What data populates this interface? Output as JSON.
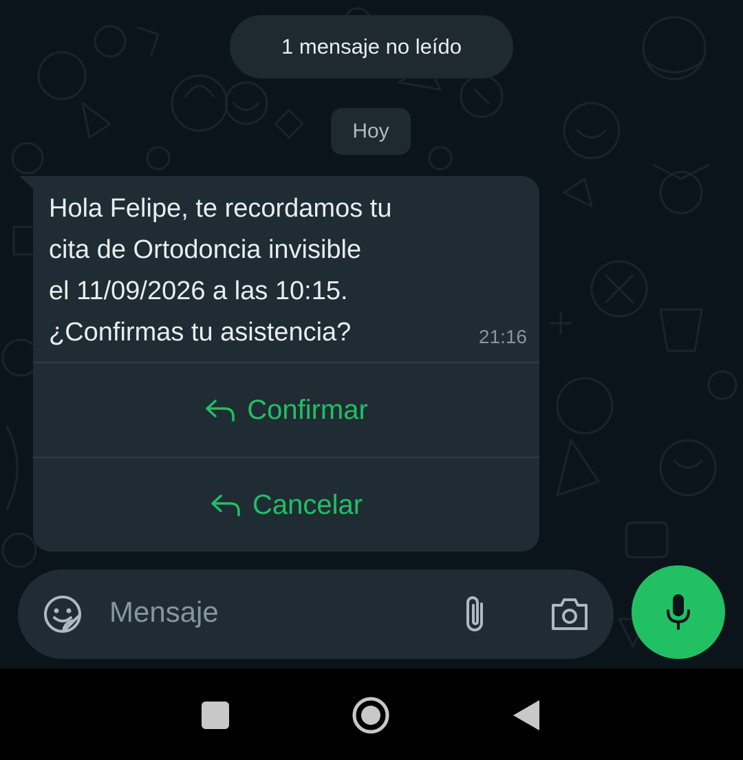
{
  "chat": {
    "unread_banner": "1 mensaje no leído",
    "date_separator": "Hoy",
    "message": {
      "lines": [
        "Hola Felipe, te recordamos tu",
        "cita de Ortodoncia invisible",
        "el 11/09/2026 a las 10:15.",
        "¿Confirmas tu asistencia?"
      ],
      "time": "21:16",
      "buttons": [
        {
          "label": "Confirmar",
          "icon": "reply-icon"
        },
        {
          "label": "Cancelar",
          "icon": "reply-icon"
        }
      ]
    }
  },
  "composer": {
    "placeholder": "Mensaje",
    "icons": [
      "sticker-icon",
      "attach-icon",
      "camera-icon",
      "mic-icon"
    ]
  },
  "navbar": {
    "icons": [
      "recents-icon",
      "home-icon",
      "back-icon"
    ]
  },
  "colors": {
    "background": "#0b141a",
    "bubble": "#1f2c34",
    "accent": "#21c063",
    "text": "#e9edef",
    "muted": "#8696a0"
  }
}
